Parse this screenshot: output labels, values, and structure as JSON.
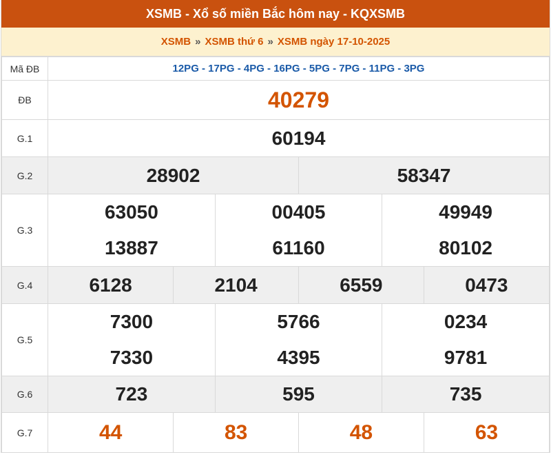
{
  "header": {
    "title": "XSMB - Xổ số miền Bắc hôm nay - KQXSMB"
  },
  "breadcrumb": {
    "items": [
      "XSMB",
      "XSMB thứ 6",
      "XSMB ngày 17-10-2025"
    ],
    "separator": "»"
  },
  "table": {
    "ma_db": {
      "label": "Mã ĐB",
      "value": "12PG - 17PG - 4PG - 16PG - 5PG - 7PG - 11PG - 3PG"
    },
    "db": {
      "label": "ĐB",
      "values": [
        "40279"
      ]
    },
    "g1": {
      "label": "G.1",
      "values": [
        "60194"
      ]
    },
    "g2": {
      "label": "G.2",
      "values": [
        "28902",
        "58347"
      ]
    },
    "g3": {
      "label": "G.3",
      "values": [
        "63050",
        "00405",
        "49949",
        "13887",
        "61160",
        "80102"
      ]
    },
    "g4": {
      "label": "G.4",
      "values": [
        "6128",
        "2104",
        "6559",
        "0473"
      ]
    },
    "g5": {
      "label": "G.5",
      "values": [
        "7300",
        "5766",
        "0234",
        "7330",
        "4395",
        "9781"
      ]
    },
    "g6": {
      "label": "G.6",
      "values": [
        "723",
        "595",
        "735"
      ]
    },
    "g7": {
      "label": "G.7",
      "values": [
        "44",
        "83",
        "48",
        "63"
      ]
    }
  },
  "colors": {
    "title_bg": "#c9510f",
    "breadcrumb_bg": "#fdf1cf",
    "accent": "#d35400",
    "code_blue": "#1a5aa8",
    "row_alt": "#efefef"
  }
}
